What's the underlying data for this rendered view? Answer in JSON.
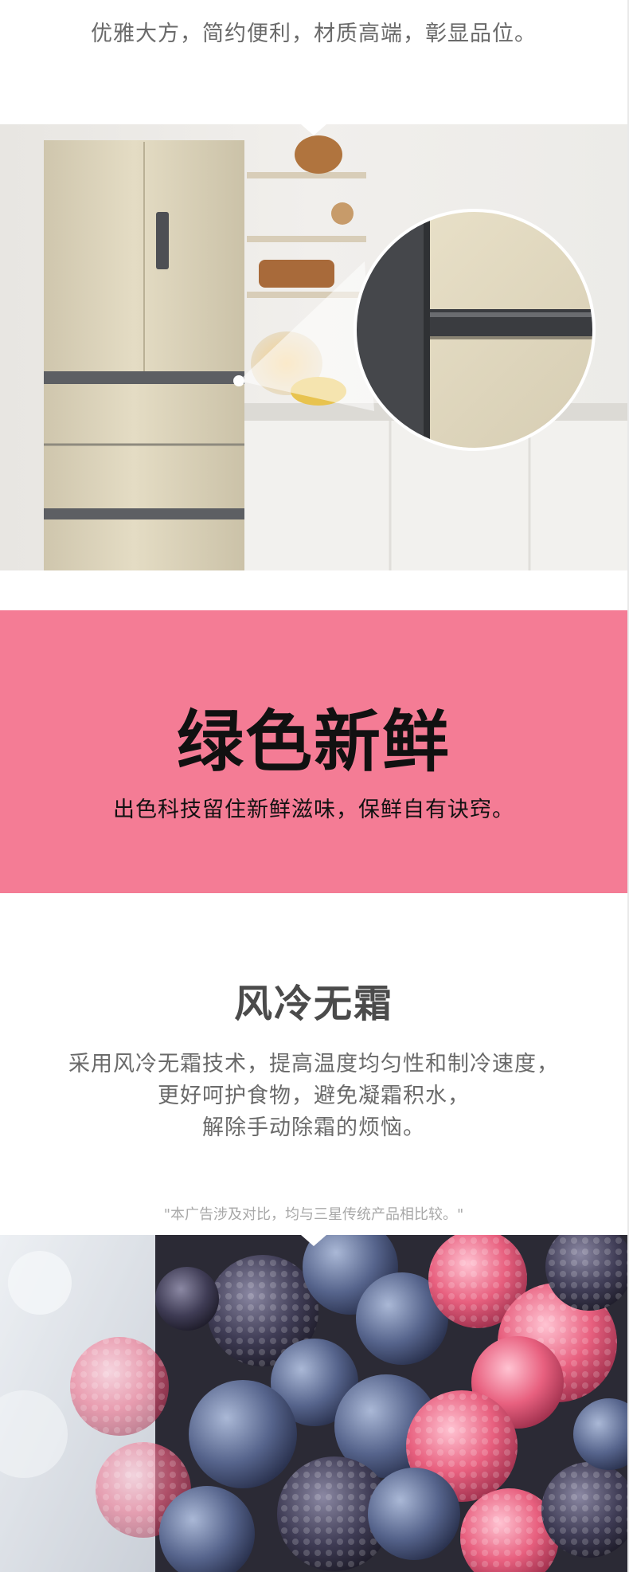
{
  "header": {
    "tagline": "优雅大方，简约便利，材质高端，彰显品位。"
  },
  "banner": {
    "title": "绿色新鲜",
    "subtitle": "出色科技留住新鲜滋味，保鲜自有诀窍。",
    "color": "#f47c95"
  },
  "feature": {
    "title": "风冷无霜",
    "lines": [
      "采用风冷无霜技术，提高温度均匀性和制冷速度，",
      "更好呵护食物，避免凝霜积水，",
      "解除手动除霜的烦恼。"
    ],
    "disclaimer": "\"本广告涉及对比，均与三星传统产品相比较。\""
  }
}
